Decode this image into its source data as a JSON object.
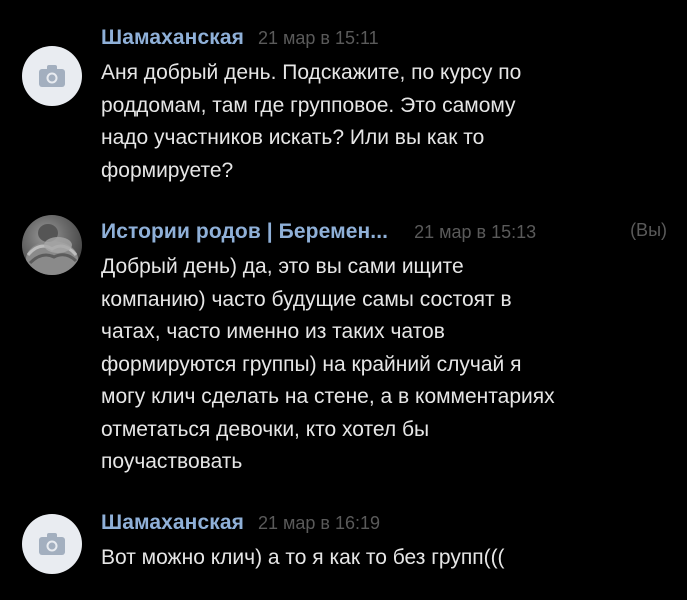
{
  "messages": [
    {
      "author": "Шамаханская",
      "time": "21 мар в 15:11",
      "avatar": "camera-icon",
      "text": "Аня добрый день. Подскажите, по курсу по\nроддомам, там где групповое. Это самому\nнадо участников искать? Или вы как то\nформируете?"
    },
    {
      "author": "Истории родов | Беремен...",
      "time": "21 мар в 15:13",
      "you_label": "(Вы)",
      "avatar": "profile-photo",
      "text": "Добрый день) да, это вы сами ищите\nкомпанию) часто будущие самы состоят в\nчатах, часто именно из таких чатов\nформируются группы) на крайний случай я\nмогу клич сделать на стене, а в комментариях\nотметаться девочки, кто хотел бы\nпоучаствовать"
    },
    {
      "author": "Шамаханская",
      "time": "21 мар в 16:19",
      "avatar": "camera-icon",
      "text": "Вот можно клич) а то я как то без групп((("
    }
  ],
  "colors": {
    "background": "#000000",
    "author": "#8fb0d8",
    "timestamp": "#5a5a5a",
    "text": "#e6e6e6"
  }
}
